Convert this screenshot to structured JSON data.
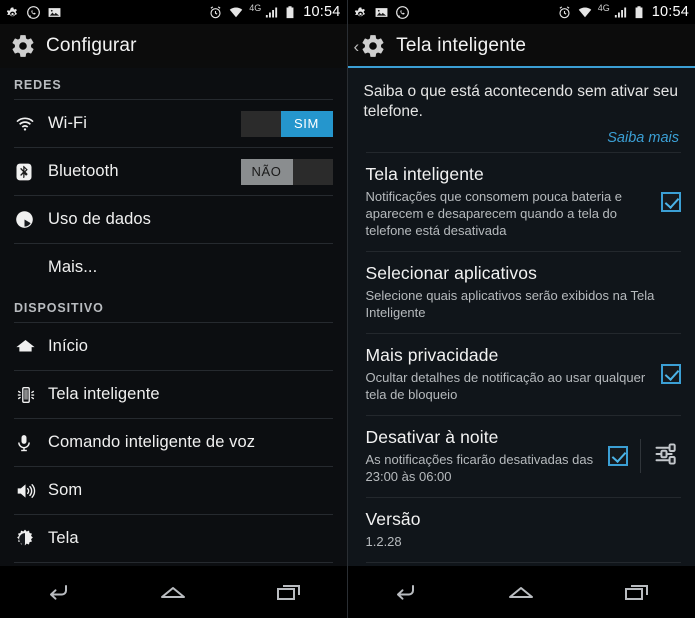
{
  "left": {
    "statusbar": {
      "icons_left": [
        "gear-icon",
        "whatsapp-icon",
        "image-icon"
      ],
      "icons_right": [
        "alarm-icon",
        "wifi-icon",
        "signal-icon",
        "battery-icon"
      ],
      "network_label": "4G",
      "clock": "10:54"
    },
    "actionbar": {
      "icon": "gear-icon",
      "title": "Configurar"
    },
    "sections": [
      {
        "header": "REDES",
        "rows": [
          {
            "icon": "wifi-icon",
            "label": "Wi-Fi",
            "toggle": {
              "state": "on",
              "label": "SIM"
            }
          },
          {
            "icon": "bluetooth-icon",
            "label": "Bluetooth",
            "toggle": {
              "state": "off",
              "label": "NÃO"
            }
          },
          {
            "icon": "data-usage-icon",
            "label": "Uso de dados",
            "toggle": null
          },
          {
            "icon": null,
            "label": "Mais...",
            "toggle": null
          }
        ]
      },
      {
        "header": "DISPOSITIVO",
        "rows": [
          {
            "icon": "home-icon",
            "label": "Início",
            "toggle": null
          },
          {
            "icon": "smart-screen-icon",
            "label": "Tela inteligente",
            "toggle": null
          },
          {
            "icon": "microphone-icon",
            "label": "Comando inteligente de voz",
            "toggle": null
          },
          {
            "icon": "speaker-icon",
            "label": "Som",
            "toggle": null
          },
          {
            "icon": "brightness-icon",
            "label": "Tela",
            "toggle": null
          }
        ]
      }
    ],
    "navbar": [
      "back-icon",
      "home-icon",
      "recents-icon"
    ]
  },
  "right": {
    "statusbar": {
      "icons_left": [
        "gear-icon",
        "image-icon",
        "whatsapp-icon"
      ],
      "icons_right": [
        "alarm-icon",
        "wifi-icon",
        "signal-icon",
        "battery-icon"
      ],
      "network_label": "4G",
      "clock": "10:54"
    },
    "actionbar": {
      "back": "‹",
      "icon": "gear-icon",
      "title": "Tela inteligente"
    },
    "intro": {
      "text": "Saiba o que está acontecendo sem ativar seu telefone.",
      "link": "Saiba mais"
    },
    "rows": [
      {
        "title": "Tela inteligente",
        "subtitle": "Notificações que consomem pouca bateria e aparecem e desaparecem quando a tela do telefone está desativada",
        "checkbox": true,
        "extra_icon": null
      },
      {
        "title": "Selecionar aplicativos",
        "subtitle": "Selecione quais aplicativos serão exibidos na Tela Inteligente",
        "checkbox": false,
        "extra_icon": null
      },
      {
        "title": "Mais privacidade",
        "subtitle": "Ocultar detalhes de notificação ao usar qualquer tela de bloqueio",
        "checkbox": true,
        "extra_icon": null
      },
      {
        "title": "Desativar à noite",
        "subtitle": "As notificações ficarão desativadas das 23:00 às 06:00",
        "checkbox": true,
        "extra_icon": "sliders-icon"
      },
      {
        "title": "Versão",
        "subtitle": "1.2.28",
        "checkbox": false,
        "extra_icon": null
      }
    ],
    "navbar": [
      "back-icon",
      "home-icon",
      "recents-icon"
    ]
  },
  "colors": {
    "accent": "#3b9fd4",
    "toggle_on": "#2596cd",
    "toggle_off_thumb": "#8a8d8f",
    "status_bar_bg": "#000000"
  }
}
